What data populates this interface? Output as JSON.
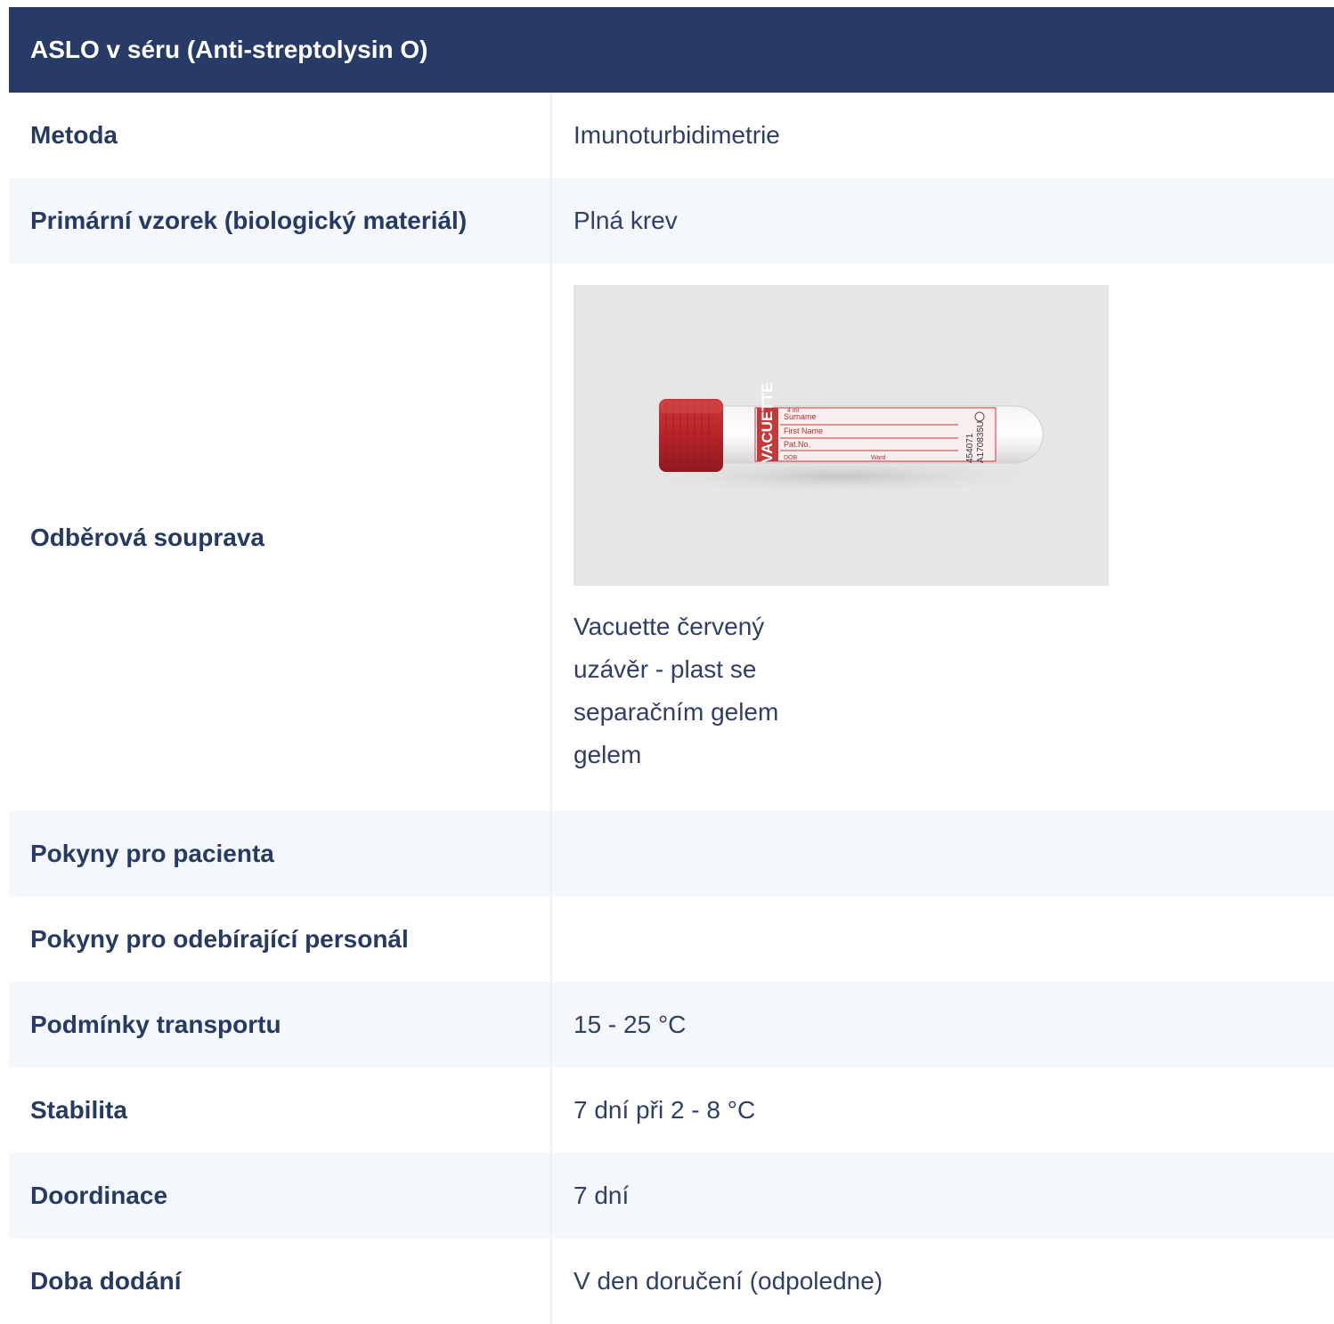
{
  "title": "ASLO v séru (Anti-streptolysin O)",
  "rows": [
    {
      "label": "Metoda",
      "value": "Imunoturbidimetrie"
    },
    {
      "label": "Primární vzorek (biologický materiál)",
      "value": "Plná krev"
    },
    {
      "label": "Odběrová souprava",
      "value": "Vacuette červený uzávěr - plast se separačním gelem gelem"
    },
    {
      "label": "Pokyny pro pacienta",
      "value": ""
    },
    {
      "label": "Pokyny pro odebírající personál",
      "value": ""
    },
    {
      "label": "Podmínky transportu",
      "value": "15 - 25 °C"
    },
    {
      "label": "Stabilita",
      "value": "7 dní při 2 - 8 °C"
    },
    {
      "label": "Doordinace",
      "value": "7 dní"
    },
    {
      "label": "Doba dodání",
      "value": "V den doručení (odpoledne)"
    }
  ],
  "tube_label": {
    "brand": "VACUETTE",
    "volume": "4 ml",
    "fields": [
      "Surname",
      "First Name",
      "Pat.No.",
      "DOB",
      "Ward"
    ],
    "codes": [
      "454071",
      "A170835U"
    ]
  },
  "colors": {
    "header_bg": "#283b66",
    "text": "#273a64",
    "alt_row": "#f4f8fd",
    "cap_red": "#b8242a"
  }
}
